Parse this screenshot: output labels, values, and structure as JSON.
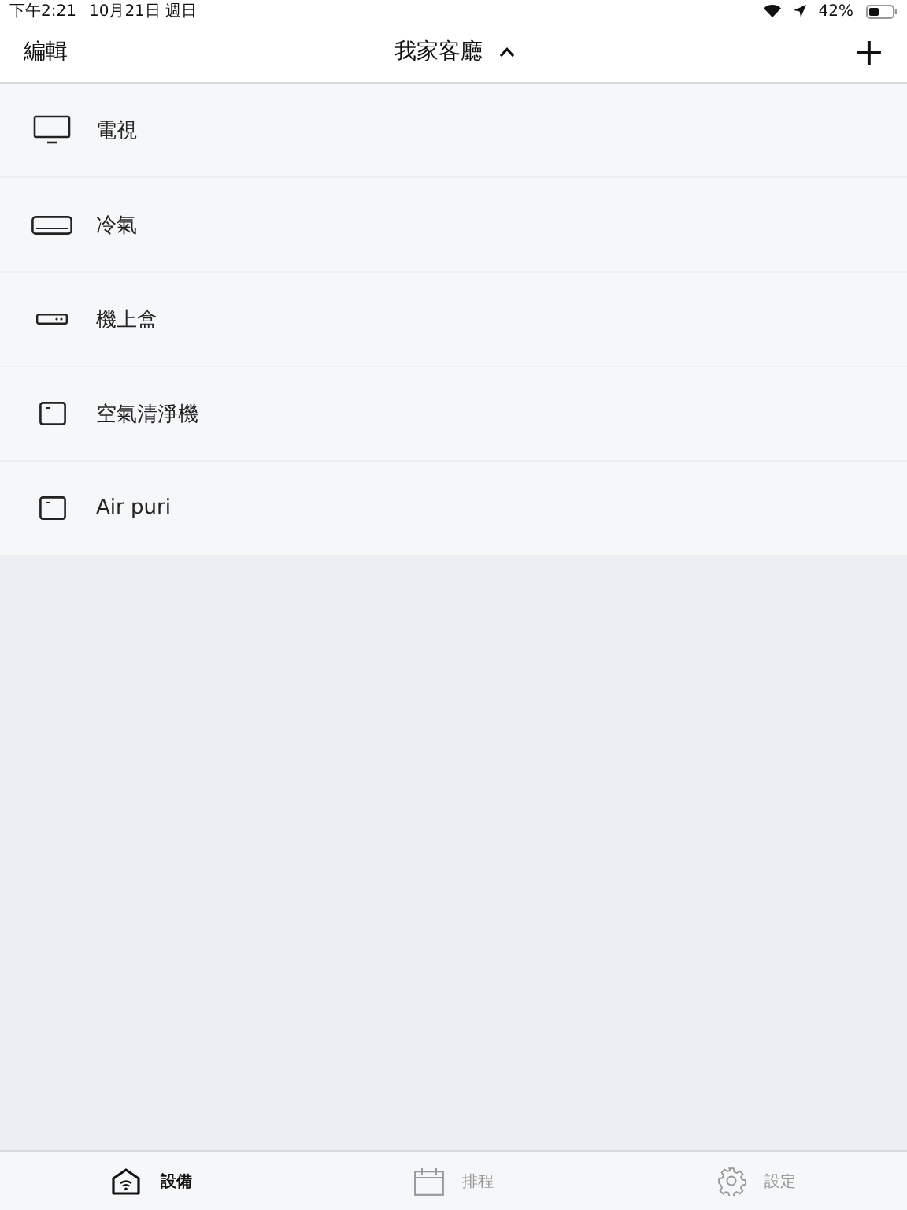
{
  "status_bar": {
    "time": "下午2:21",
    "date": "10月21日 週日",
    "battery": "42%"
  },
  "nav_bar": {
    "edit": "編輯",
    "title": "我家客廳",
    "add": "+"
  },
  "devices": [
    {
      "kind": "tv",
      "name": "電視"
    },
    {
      "kind": "ac",
      "name": "冷氣"
    },
    {
      "kind": "box",
      "name": "機上盒"
    },
    {
      "kind": "purifier",
      "name": "空氣清淨機"
    },
    {
      "kind": "purifier",
      "name": "Air puri"
    }
  ],
  "tab_bar": [
    {
      "kind": "devices",
      "label": "設備",
      "selected": true
    },
    {
      "kind": "schedule",
      "label": "排程",
      "selected": false
    },
    {
      "kind": "settings",
      "label": "設定",
      "selected": false
    }
  ]
}
